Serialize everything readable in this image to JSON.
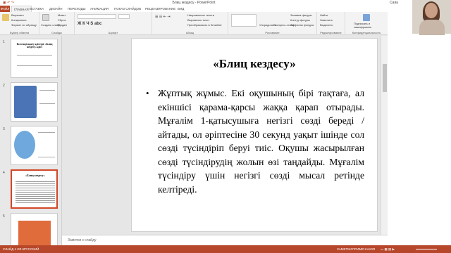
{
  "window": {
    "title": "Блиц кездесу - PowerPoint",
    "user": "Саяа"
  },
  "tabs": [
    "ФАЙЛ",
    "ГЛАВНАЯ",
    "ВСТАВКА",
    "ДИЗАЙН",
    "ПЕРЕХОДЫ",
    "АНИМАЦИЯ",
    "ПОКАЗ СЛАЙДОВ",
    "РЕЦЕНЗИРОВАНИЕ",
    "ВИД"
  ],
  "ribbon": {
    "clipboard": {
      "cut": "Вырезать",
      "copy": "Копировать",
      "format": "Формат по образцу",
      "label": "Буфер обмена"
    },
    "slides": {
      "new": "Создать слайд",
      "layout": "Макет",
      "reset": "Сброс",
      "section": "Раздел",
      "label": "Слайды"
    },
    "font": {
      "label": "Шрифт"
    },
    "paragraph": {
      "dir": "Направление текста",
      "align": "Выровнять текст",
      "smartart": "Преобразовать в SmartArt",
      "label": "Абзац"
    },
    "drawing": {
      "arrange": "Упорядочить",
      "styles": "Экспресс-стили",
      "fill": "Заливка фигуры",
      "outline": "Контур фигуры",
      "effects": "Эффекты фигуры",
      "label": "Рисование"
    },
    "editing": {
      "find": "Найти",
      "replace": "Заменить",
      "select": "Выделить",
      "label": "Редактирование"
    },
    "sign": {
      "label1": "Подписать и",
      "label2": "зашифровать",
      "label": "Конфиденциальность"
    }
  },
  "thumbnails": [
    {
      "num": "1",
      "title": "Белсенді оқыту әдістері: «Блиц кездесу» әдісі"
    },
    {
      "num": "2",
      "title": ""
    },
    {
      "num": "3",
      "title": ""
    },
    {
      "num": "4",
      "title": "«Блиц кездесу»"
    },
    {
      "num": "5",
      "title": ""
    }
  ],
  "slide": {
    "title": "«Блиц кездесу»",
    "bullet": "•",
    "body": "Жұптық жұмыс. Екі оқушының бірі тақтаға, ал екіншісі қарама-қарсы жаққа қарап отырады. Мұғалім 1-қатысушыға негізгі сөзді береді / айтады, ол әріптесіне 30 секунд уақыт ішінде сол сөзді түсіндіріп беруі тиіс. Оқушы жасырылған сөзді түсіндірудің жолын өзі таңдайды. Мұғалім түсіндіру үшін негізгі сөзді мысал ретінде келтіреді."
  },
  "notes": {
    "placeholder": "Заметки к слайду"
  },
  "status": {
    "slide": "СЛАЙД 4 ИЗ 6",
    "lang": "РУССКИЙ",
    "notes": "ЗАМЕТКИ",
    "comments": "ПРИМЕЧАНИЯ"
  },
  "colors": {
    "accent": "#b7472a",
    "selection": "#d24726"
  }
}
